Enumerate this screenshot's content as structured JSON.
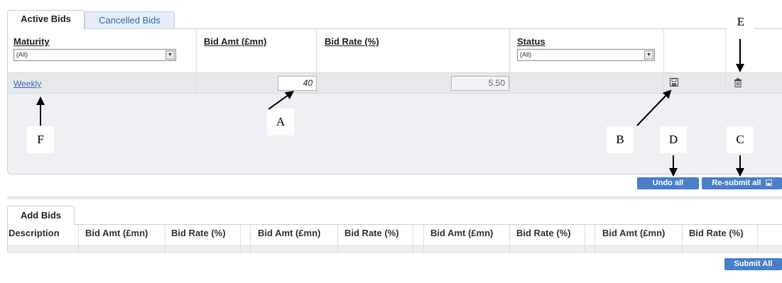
{
  "tabs": {
    "active": "Active Bids",
    "cancelled": "Cancelled Bids"
  },
  "active_table": {
    "columns": {
      "maturity": "Maturity",
      "bid_amt": "Bid Amt (£mn)",
      "bid_rate": "Bid Rate (%)",
      "status": "Status"
    },
    "filters": {
      "maturity": "(All)",
      "status": "(All)"
    },
    "rows": [
      {
        "maturity": "Weekly",
        "bid_amt": "40",
        "bid_rate": "5.50"
      }
    ]
  },
  "buttons": {
    "undo_all": "Undo all",
    "resubmit_all": "Re-submit all",
    "submit_all": "Submit All"
  },
  "add_bids": {
    "tab": "Add Bids",
    "columns": [
      "Description",
      "Bid Amt (£mn)",
      "Bid Rate (%)",
      "Bid Amt (£mn)",
      "Bid Rate (%)",
      "Bid Amt (£mn)",
      "Bid Rate (%)",
      "Bid Amt (£mn)",
      "Bid Rate (%)"
    ]
  },
  "callouts": {
    "a": "A",
    "b": "B",
    "c": "C",
    "d": "D",
    "e": "E",
    "f": "F"
  },
  "icons": {
    "save": "save-icon",
    "delete": "trash-icon",
    "dropdown": "chevron-down-icon"
  }
}
